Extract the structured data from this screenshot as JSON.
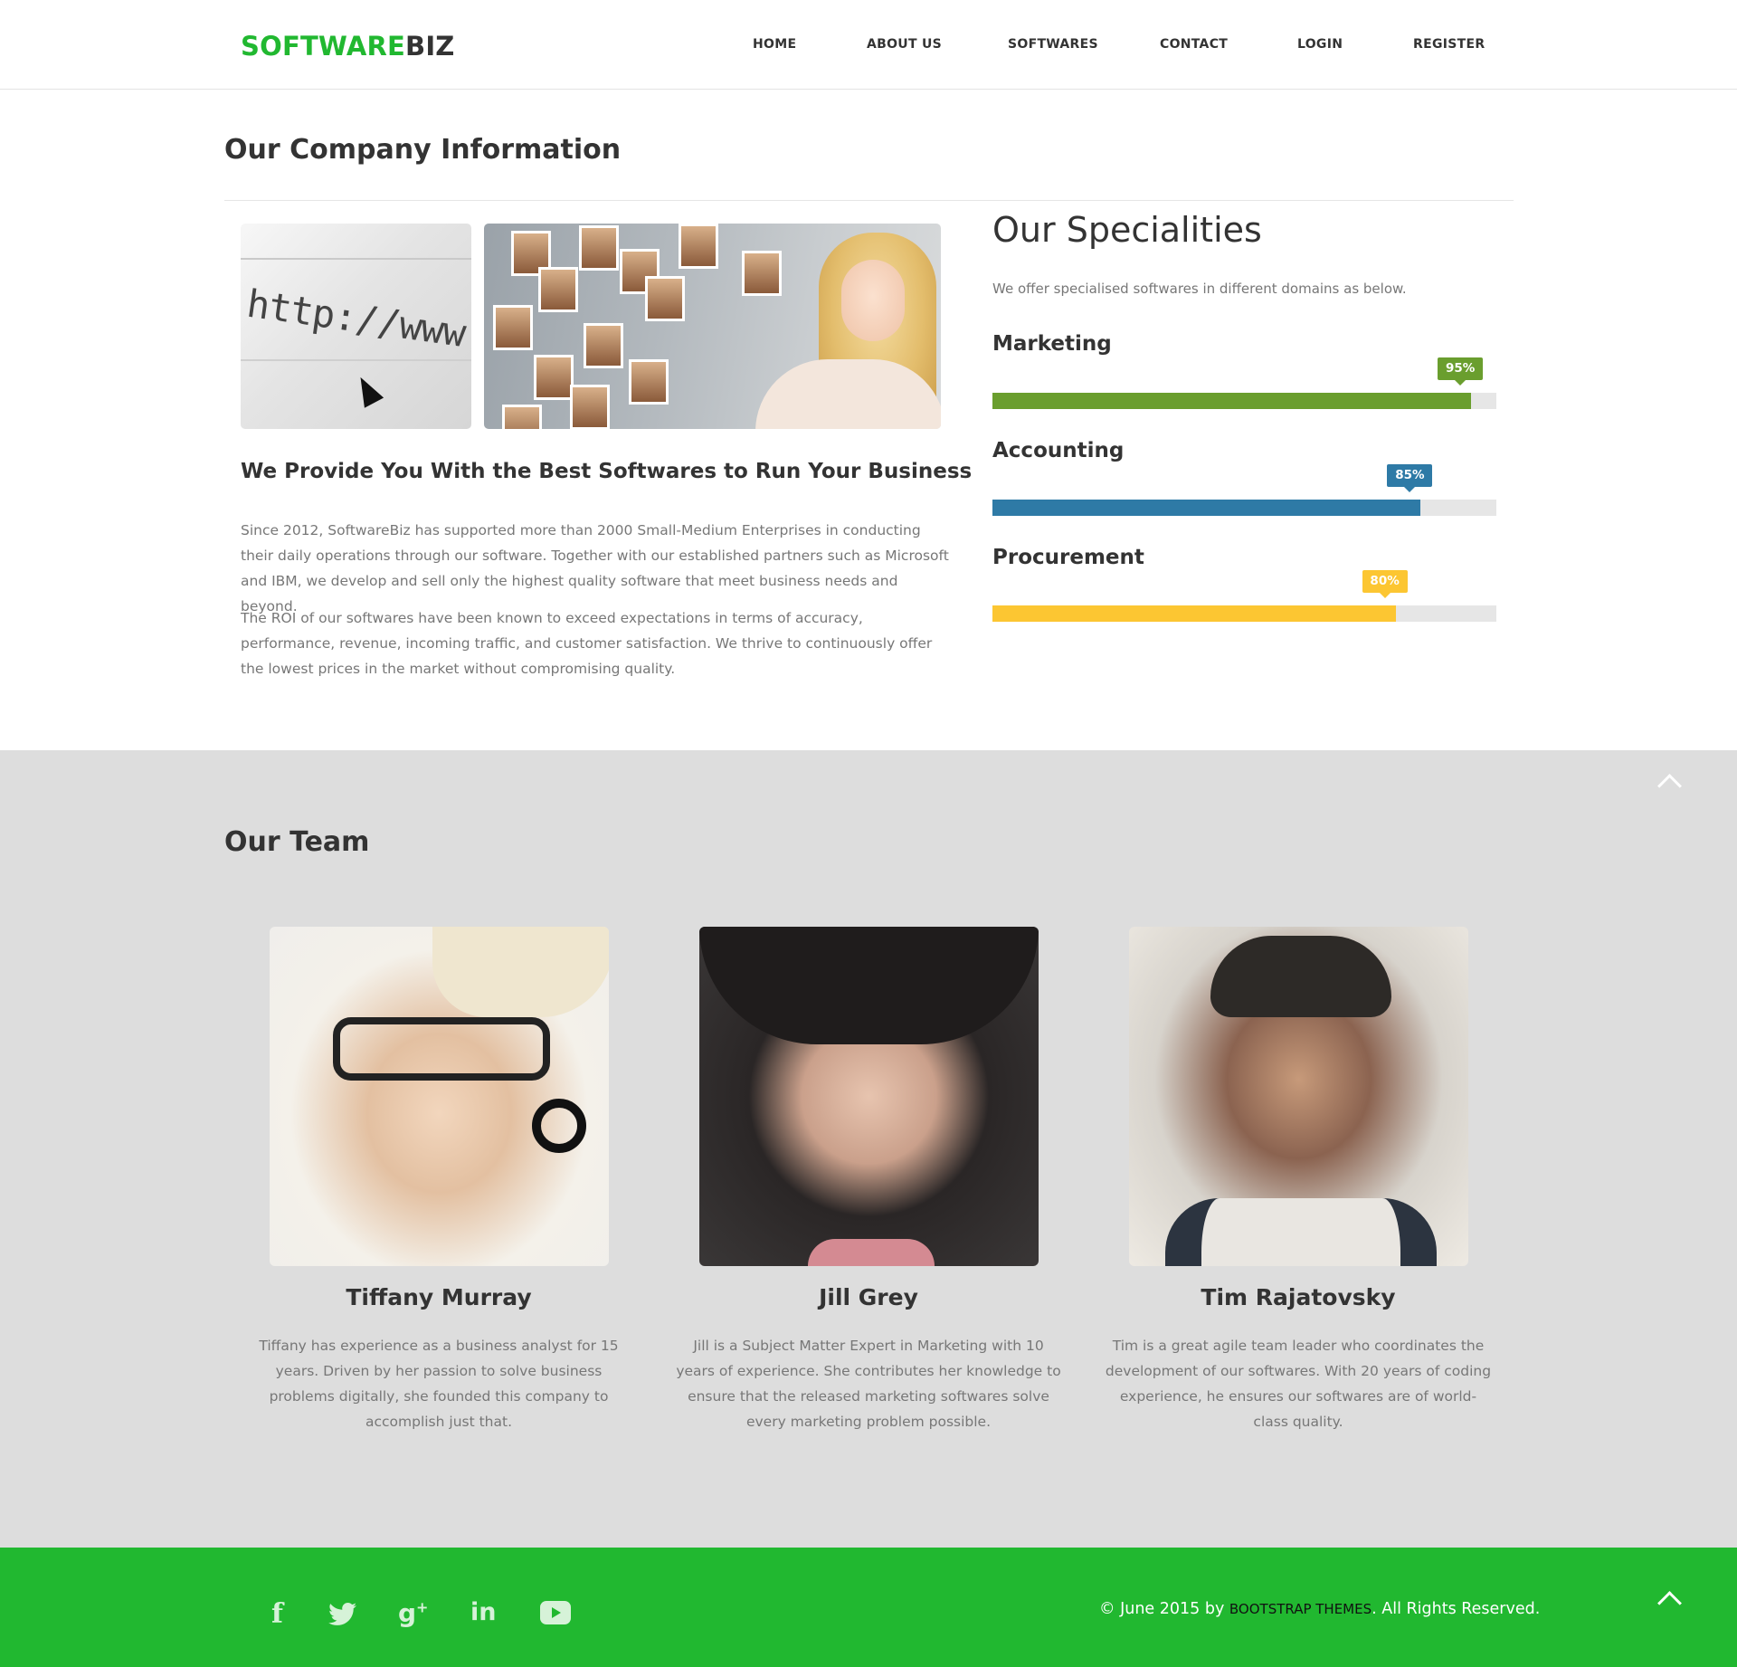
{
  "header": {
    "logo_part1": "SOFTWARE",
    "logo_part2": "BIZ",
    "nav": [
      "HOME",
      "ABOUT US",
      "SOFTWARES",
      "CONTACT",
      "LOGIN",
      "REGISTER"
    ]
  },
  "company": {
    "title": "Our Company Information",
    "image_text": "http://www.",
    "subheading": "We Provide You With the Best Softwares to Run Your Business",
    "paragraph1": "Since 2012, SoftwareBiz has supported more than 2000 Small-Medium Enterprises in conducting their daily operations through our software. Together with our established partners such as Microsoft and IBM, we develop and sell only the highest quality software that meet business needs and beyond.",
    "paragraph2": "The ROI of our softwares have been known to exceed expectations in terms of accuracy, performance, revenue, incoming traffic, and customer satisfaction. We thrive to continuously offer the lowest prices in the market without compromising quality."
  },
  "specialities": {
    "title": "Our Specialities",
    "subtitle": "We offer specialised softwares in different domains as below.",
    "skills": [
      {
        "name": "Marketing",
        "percent": 95,
        "label": "95%",
        "color": "#6a9e2e"
      },
      {
        "name": "Accounting",
        "percent": 85,
        "label": "85%",
        "color": "#2e7aa6"
      },
      {
        "name": "Procurement",
        "percent": 80,
        "label": "80%",
        "color": "#fcc632"
      }
    ]
  },
  "team": {
    "title": "Our Team",
    "members": [
      {
        "name": "Tiffany Murray",
        "bio": "Tiffany has experience as a business analyst for 15 years. Driven by her passion to solve business problems digitally, she founded this company to accomplish just that."
      },
      {
        "name": "Jill Grey",
        "bio": "Jill is a Subject Matter Expert in Marketing with 10 years of experience. She contributes her knowledge to ensure that the released marketing softwares solve every marketing problem possible."
      },
      {
        "name": "Tim Rajatovsky",
        "bio": "Tim is a great agile team leader who coordinates the development of our softwares. With 20 years of coding experience, he ensures our softwares are of world-class quality."
      }
    ]
  },
  "footer": {
    "social_icons": [
      "facebook-icon",
      "twitter-icon",
      "google-plus-icon",
      "linkedin-icon",
      "youtube-icon"
    ],
    "copyright_prefix": "© June 2015 by",
    "copyright_brand": "BOOTSTRAP THEMES",
    "copyright_suffix": ". All Rights Reserved."
  },
  "colors": {
    "brand_green": "#21b830",
    "team_background": "#dddddd"
  }
}
